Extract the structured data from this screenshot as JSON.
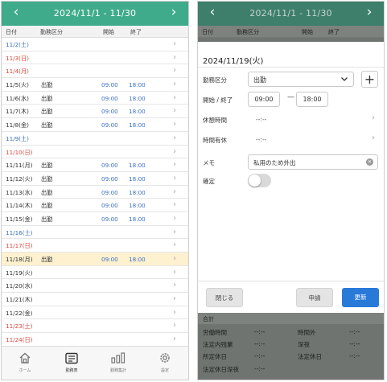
{
  "header": {
    "title": "2024/11/1 - 11/30",
    "prev_icon": "‹",
    "next_icon": "›"
  },
  "columns": {
    "date": "日付",
    "kind": "勤務区分",
    "start": "開始",
    "end": "終了"
  },
  "rows": [
    {
      "date": "11/2(土)",
      "color": "blue",
      "kind": "",
      "start": "",
      "end": ""
    },
    {
      "date": "11/3(日)",
      "color": "red",
      "kind": "",
      "start": "",
      "end": ""
    },
    {
      "date": "11/4(月)",
      "color": "red",
      "kind": "",
      "start": "",
      "end": ""
    },
    {
      "date": "11/5(火)",
      "color": "plain",
      "kind": "出勤",
      "start": "09:00",
      "end": "18:00"
    },
    {
      "date": "11/6(水)",
      "color": "plain",
      "kind": "出勤",
      "start": "09:00",
      "end": "18:00"
    },
    {
      "date": "11/7(木)",
      "color": "plain",
      "kind": "出勤",
      "start": "09:00",
      "end": "18:00"
    },
    {
      "date": "11/8(金)",
      "color": "plain",
      "kind": "出勤",
      "start": "09:00",
      "end": "18:00"
    },
    {
      "date": "11/9(土)",
      "color": "blue",
      "kind": "",
      "start": "",
      "end": ""
    },
    {
      "date": "11/10(日)",
      "color": "red",
      "kind": "",
      "start": "",
      "end": ""
    },
    {
      "date": "11/11(月)",
      "color": "plain",
      "kind": "出勤",
      "start": "09:00",
      "end": "18:00"
    },
    {
      "date": "11/12(火)",
      "color": "plain",
      "kind": "出勤",
      "start": "09:00",
      "end": "18:00"
    },
    {
      "date": "11/13(水)",
      "color": "plain",
      "kind": "出勤",
      "start": "09:00",
      "end": "18:00"
    },
    {
      "date": "11/14(木)",
      "color": "plain",
      "kind": "出勤",
      "start": "09:00",
      "end": "18:00"
    },
    {
      "date": "11/15(金)",
      "color": "plain",
      "kind": "出勤",
      "start": "09:00",
      "end": "18:00"
    },
    {
      "date": "11/16(土)",
      "color": "blue",
      "kind": "",
      "start": "",
      "end": ""
    },
    {
      "date": "11/17(日)",
      "color": "red",
      "kind": "",
      "start": "",
      "end": ""
    },
    {
      "date": "11/18(月)",
      "color": "plain",
      "kind": "出勤",
      "start": "09:00",
      "end": "18:00",
      "highlight": true
    },
    {
      "date": "11/19(火)",
      "color": "plain",
      "kind": "",
      "start": "",
      "end": ""
    },
    {
      "date": "11/20(水)",
      "color": "plain",
      "kind": "",
      "start": "",
      "end": ""
    },
    {
      "date": "11/21(木)",
      "color": "plain",
      "kind": "",
      "start": "",
      "end": ""
    },
    {
      "date": "11/22(金)",
      "color": "plain",
      "kind": "",
      "start": "",
      "end": ""
    },
    {
      "date": "11/23(土)",
      "color": "red",
      "kind": "",
      "start": "",
      "end": ""
    },
    {
      "date": "11/24(日)",
      "color": "red",
      "kind": "",
      "start": "",
      "end": ""
    }
  ],
  "tabbar": [
    {
      "label": "ホーム",
      "icon": "home-icon"
    },
    {
      "label": "勤務表",
      "icon": "timesheet-icon"
    },
    {
      "label": "勤務集計",
      "icon": "bar-chart-icon"
    },
    {
      "label": "設定",
      "icon": "gear-icon"
    }
  ],
  "detail": {
    "date": "2024/11/19(火)",
    "kind_label": "勤務区分",
    "kind_value": "出勤",
    "time_label": "開始 / 終了",
    "start": "09:00",
    "end": "18:00",
    "dash": "—",
    "break_label": "休憩時間",
    "break_value": "--:--",
    "paid_label": "時間有休",
    "paid_value": "--:--",
    "memo_label": "メモ",
    "memo_value": "私用のため外出",
    "confirm_label": "確定",
    "confirm_value": false,
    "close_button": "閉じる",
    "apply_button": "申請",
    "update_button": "更新"
  },
  "summary": {
    "title": "合計",
    "items": [
      {
        "label": "労働時間",
        "value": "--:--"
      },
      {
        "label": "時間外",
        "value": "--:--"
      },
      {
        "label": "法定内残業",
        "value": "--:--"
      },
      {
        "label": "深夜",
        "value": "--:--"
      },
      {
        "label": "所定休日",
        "value": "--:--"
      },
      {
        "label": "法定休日",
        "value": "--:--"
      },
      {
        "label": "法定休日深夜",
        "value": "--:--"
      }
    ]
  },
  "colors": {
    "header": "#3fab8a",
    "accent": "#2979d9",
    "highlight": "#fdf1cf",
    "sunday": "#e0453a",
    "saturday": "#3c6fc4"
  }
}
